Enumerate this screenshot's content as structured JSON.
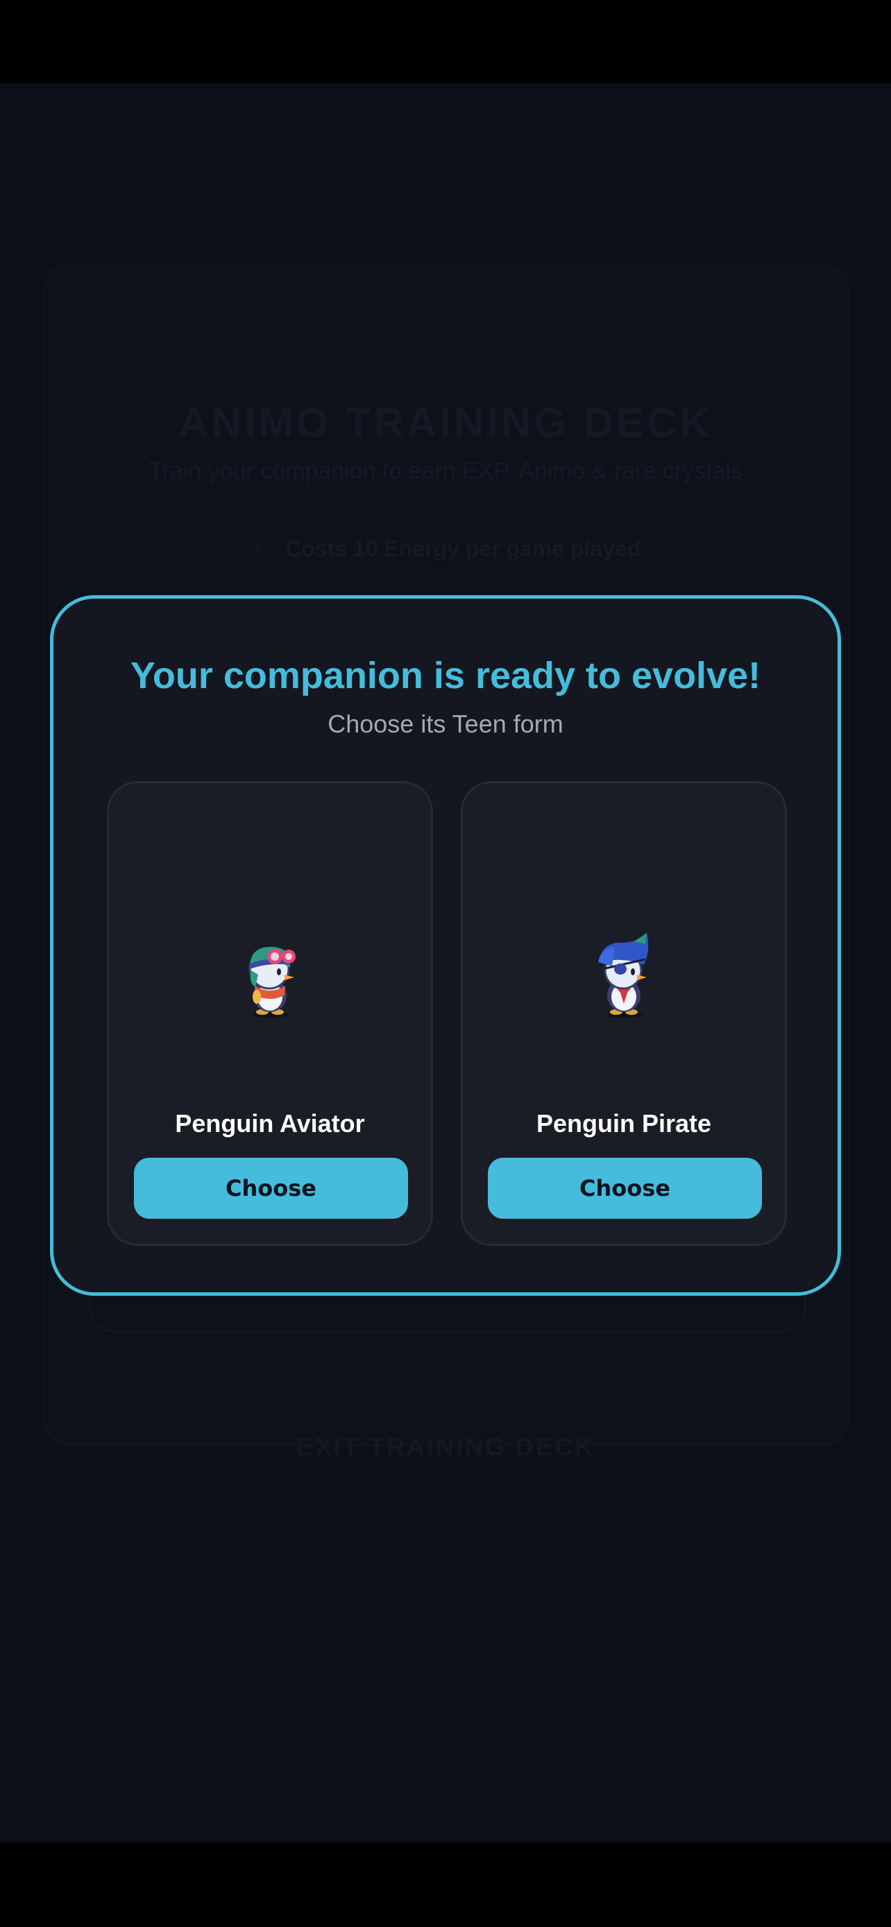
{
  "background": {
    "title": "ANIMO TRAINING DECK",
    "subtitle": "Train your companion to earn EXP, Animo & rare crystals",
    "energy_note": "Costs 10 Energy per game played",
    "exit_label": "EXIT TRAINING DECK"
  },
  "modal": {
    "title": "Your companion is ready to evolve!",
    "subtitle": "Choose its Teen form",
    "options": [
      {
        "name": "Penguin Aviator",
        "button_label": "Choose",
        "icon": "penguin-aviator-sprite"
      },
      {
        "name": "Penguin Pirate",
        "button_label": "Choose",
        "icon": "penguin-pirate-sprite"
      }
    ]
  },
  "colors": {
    "accent": "#45bcdc",
    "modal_bg": "#14171f",
    "card_bg": "#1a1d25",
    "page_bg": "#0b0f17"
  }
}
